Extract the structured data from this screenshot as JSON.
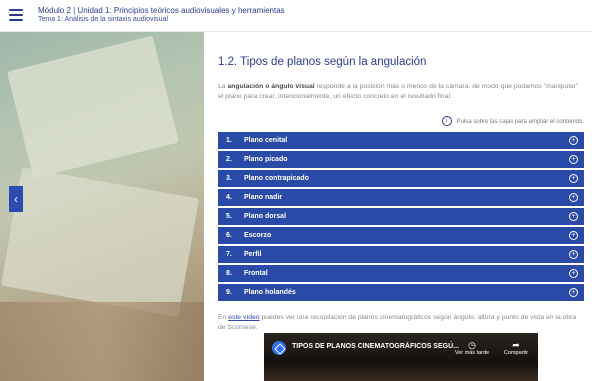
{
  "header": {
    "course": "Módulo 2 | Unidad 1: Principios teóricos audiovisuales y herramientas",
    "topic": "Tema 1: Análisis de la sintaxis audiovisual"
  },
  "content": {
    "title": "1.2. Tipos de planos según la angulación",
    "intro_bold": "angulación o ángulo visual",
    "intro_pre": "La ",
    "intro_post": " responde a la posición más o menos de la cámara, de modo que podamos \"manipular\" el plano para crear, intencionalmente, un efecto concreto en el resultado final.",
    "hint": "Pulsa sobre las cajas para ampliar el contenido.",
    "accordion": [
      {
        "num": "1.",
        "label": "Plano cenital"
      },
      {
        "num": "2.",
        "label": "Plano picado"
      },
      {
        "num": "3.",
        "label": "Plano contrapicado"
      },
      {
        "num": "4.",
        "label": "Plano nadir"
      },
      {
        "num": "5.",
        "label": "Plano dorsal"
      },
      {
        "num": "6.",
        "label": "Escorzo"
      },
      {
        "num": "7.",
        "label": "Perfil"
      },
      {
        "num": "8.",
        "label": "Frontal"
      },
      {
        "num": "9.",
        "label": "Plano holandés"
      }
    ],
    "outro_pre": "En ",
    "outro_link": "este vídeo",
    "outro_post": " puedes ver una recopilación de planos cinematográficos según ángulo, altura y punto de vista en la obra de Scorsese."
  },
  "video": {
    "title": "TIPOS DE PLANOS CINEMATOGRÁFICOS SEGÚ...",
    "watch_later": "Ver más tarde",
    "share": "Compartir"
  },
  "colors": {
    "accent": "#2a4aa8",
    "title": "#2b3a8c"
  },
  "icons": {
    "menu": "hamburger-icon",
    "back": "chevron-left-icon",
    "info": "info-icon",
    "expand": "plus-circle-icon"
  }
}
